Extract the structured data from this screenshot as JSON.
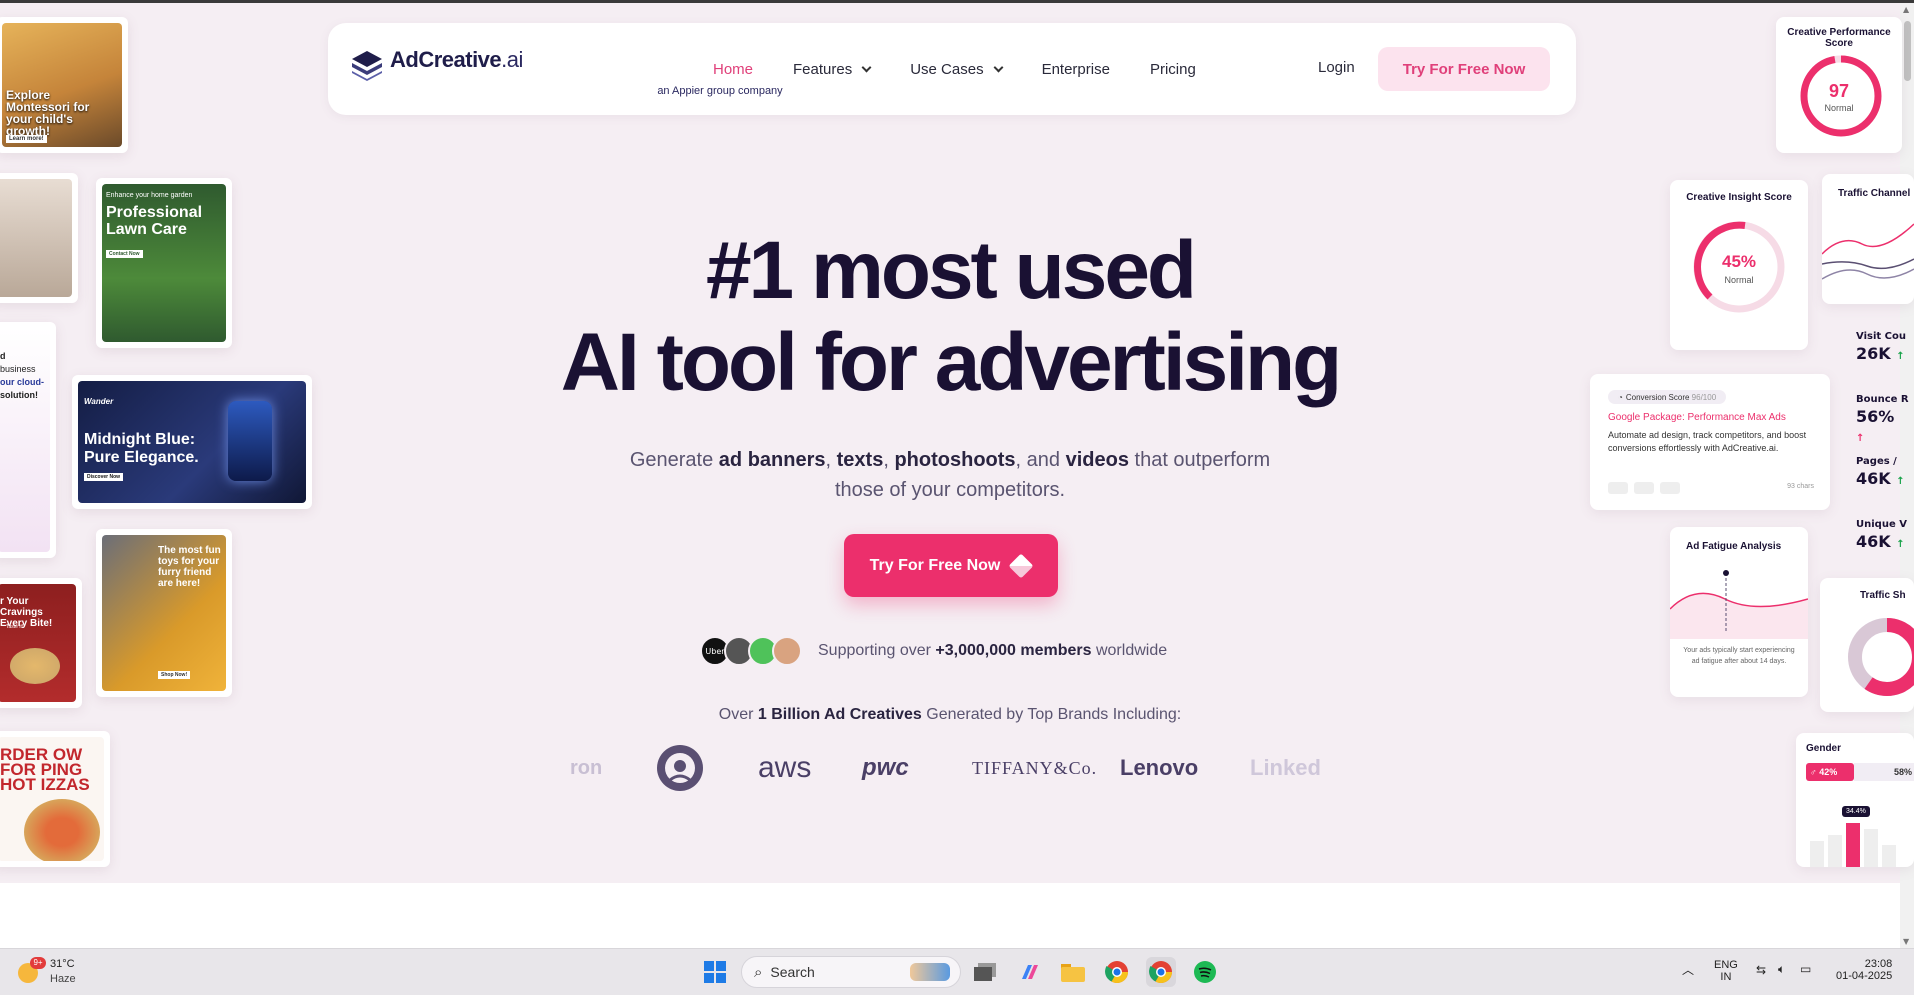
{
  "nav": {
    "logo_name": "AdCreative",
    "logo_suffix": ".ai",
    "logo_sub": "an Appier group company",
    "links": [
      {
        "label": "Home"
      },
      {
        "label": "Features"
      },
      {
        "label": "Use Cases"
      },
      {
        "label": "Enterprise"
      },
      {
        "label": "Pricing"
      }
    ],
    "login": "Login",
    "cta": "Try For Free Now"
  },
  "hero": {
    "line1": "#1 most used",
    "line2": "AI tool for advertising",
    "sub_1": "Generate ",
    "sub_b1": "ad banners",
    "sub_2": ", ",
    "sub_b2": "texts",
    "sub_3": ", ",
    "sub_b3": "photoshoots",
    "sub_4": ", and ",
    "sub_b4": "videos",
    "sub_5": " that outperform those of your competitors.",
    "cta": "Try For Free Now",
    "members_pre": "Supporting over ",
    "members_b": "+3,000,000 members",
    "members_post": " worldwide",
    "avatar_uber": "Uber",
    "brands_pre": "Over ",
    "brands_b": "1 Billion Ad Creatives",
    "brands_post": " Generated by Top Brands Including:"
  },
  "brands": [
    "ron",
    "aws",
    "pwc",
    "TIFFANY&Co.",
    "Lenovo",
    "Linked"
  ],
  "creatives": {
    "c1": "Explore Montessori for your child's growth!",
    "c1_btn": "Learn more!",
    "c3_small": "Enhance your home garden",
    "c3": "Professional Lawn Care",
    "c3_btn": "Contact Now",
    "c4a": "d",
    "c4b": "business",
    "c4c": "our cloud-",
    "c4d": "solution!",
    "c5_brand": "Wander",
    "c5": "Midnight Blue: Pure Elegance.",
    "c5_btn": "Discover Now",
    "c6": "The most fun toys for your furry friend are here!",
    "c6_btn": "Shop Now!",
    "c7": "r Your Cravings Every Bite!",
    "c7_btn": "Taste it!",
    "c8": "RDER OW FOR PING HOT IZZAS"
  },
  "widgets": {
    "perf_title": "Creative Performance Score",
    "perf_value": "97",
    "perf_status": "Normal",
    "insight_title": "Creative Insight Score",
    "insight_value": "45%",
    "insight_status": "Normal",
    "traffic_channel": "Traffic Channel",
    "stats": [
      {
        "k": "Visit Cou",
        "v": "26K"
      },
      {
        "k": "Bounce R",
        "v": "56%"
      },
      {
        "k": "Pages /",
        "v": "46K"
      },
      {
        "k": "Unique V",
        "v": "46K"
      }
    ],
    "conv_label": "Conversion Score",
    "conv_score": "96/100",
    "conv_title": "Google Package: Performance Max Ads",
    "conv_text": "Automate ad design, track competitors, and boost conversions effortlessly with AdCreative.ai.",
    "conv_chars": "93 chars",
    "fatigue_title": "Ad Fatigue Analysis",
    "fatigue_text": "Your ads typically start experiencing ad fatigue after about 14 days.",
    "traffic_sh": "Traffic Sh",
    "gender_title": "Gender",
    "gender_m": "42%",
    "gender_f": "58%",
    "gender_bar": "34.4%"
  },
  "taskbar": {
    "temp": "31°C",
    "weather": "Haze",
    "badge": "9+",
    "search": "Search",
    "lang1": "ENG",
    "lang2": "IN",
    "time": "23:08",
    "date": "01-04-2025"
  }
}
